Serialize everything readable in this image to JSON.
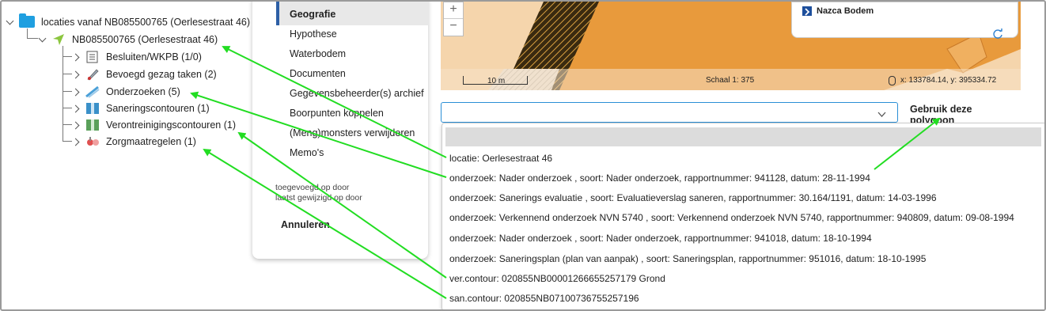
{
  "tree": {
    "root_label": "locaties vanaf NB085500765 (Oerlesestraat 46)",
    "location_label": "NB085500765 (Oerlesestraat 46)",
    "children": [
      {
        "label": "Besluiten/WKPB (1/0)",
        "icon": "document-list-icon"
      },
      {
        "label": "Bevoegd gezag taken (2)",
        "icon": "pen-task-icon"
      },
      {
        "label": "Onderzoeken (5)",
        "icon": "investigation-icon"
      },
      {
        "label": "Saneringscontouren (1)",
        "icon": "remediation-contour-icon"
      },
      {
        "label": "Verontreinigingscontouren (1)",
        "icon": "contamination-contour-icon"
      },
      {
        "label": "Zorgmaatregelen (1)",
        "icon": "care-measure-icon"
      }
    ]
  },
  "menu": {
    "items": [
      "Geografie",
      "Hypothese",
      "Waterbodem",
      "Documenten",
      "Gegevensbeheerder(s) archief",
      "Boorpunten koppelen",
      "(Meng)monsters verwijderen",
      "Memo's"
    ],
    "selected": "Geografie",
    "added_by": "toegevoegd op door",
    "changed_by": "laatst gewijzigd op door",
    "cancel": "Annuleren"
  },
  "map": {
    "zoom_in": "+",
    "zoom_out": "−",
    "layer_label": "Nazca Bodem",
    "scale_bar": "10 m",
    "scale_text": "Schaal 1: 375",
    "coords": "x: 133784.14, y: 395334.72"
  },
  "select": {
    "value": "",
    "use_button": "Gebruik deze polygoon"
  },
  "dropdown": {
    "options": [
      "",
      "locatie: Oerlesestraat 46",
      "onderzoek: Nader onderzoek , soort: Nader onderzoek, rapportnummer: 941128, datum: 28-11-1994",
      "onderzoek: Sanerings evaluatie , soort: Evaluatieverslag saneren, rapportnummer: 30.164/1191, datum: 14-03-1996",
      "onderzoek: Verkennend onderzoek NVN 5740 , soort: Verkennend onderzoek NVN 5740, rapportnummer: 940809, datum: 09-08-1994",
      "onderzoek: Nader onderzoek , soort: Nader onderzoek, rapportnummer: 941018, datum: 18-10-1994",
      "onderzoek: Saneringsplan (plan van aanpak) , soort: Saneringsplan, rapportnummer: 951016, datum: 18-10-1995",
      "ver.contour: 020855NB00001266655257179 Grond",
      "san.contour: 020855NB07100736755257196"
    ]
  },
  "colors": {
    "arrow": "#22dd22",
    "accent": "#2b8fd6",
    "map_orange": "#e89a3c"
  }
}
